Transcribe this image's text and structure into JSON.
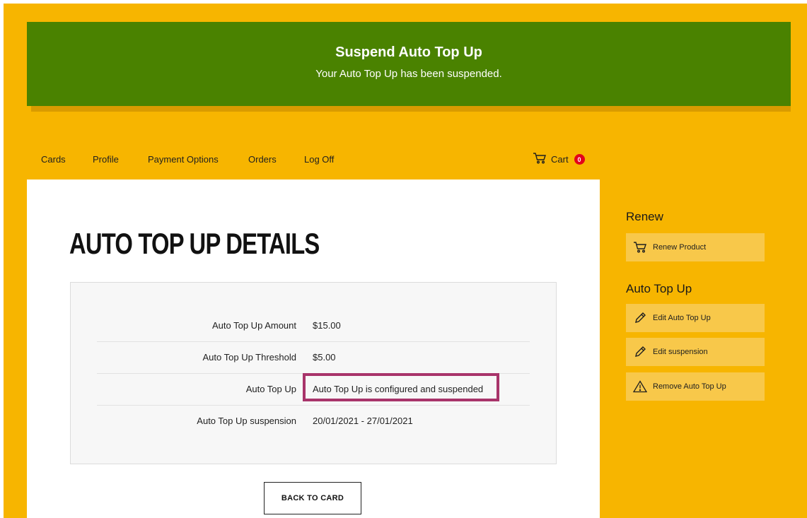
{
  "banner": {
    "title": "Suspend Auto Top Up",
    "message": "Your Auto Top Up has been suspended."
  },
  "nav": {
    "items": [
      "Cards",
      "Profile",
      "Payment Options",
      "Orders",
      "Log Off"
    ],
    "cart_label": "Cart",
    "cart_count": "0"
  },
  "main": {
    "title": "AUTO TOP UP DETAILS",
    "details": [
      {
        "label": "Auto Top Up Amount",
        "value": "$15.00"
      },
      {
        "label": "Auto Top Up Threshold",
        "value": "$5.00"
      },
      {
        "label": "Auto Top Up",
        "value": "Auto Top Up is configured and suspended"
      },
      {
        "label": "Auto Top Up suspension",
        "value": "20/01/2021 - 27/01/2021"
      }
    ],
    "back_button": "BACK TO CARD"
  },
  "sidebar": {
    "renew_heading": "Renew",
    "renew_button": "Renew Product",
    "auto_heading": "Auto Top Up",
    "edit_button": "Edit Auto Top Up",
    "edit_suspension_button": "Edit suspension",
    "remove_button": "Remove Auto Top Up"
  },
  "icons": {
    "cart": "cart-icon",
    "pencil": "pencil-icon",
    "warning": "warning-icon"
  },
  "colors": {
    "page_background": "#f7b500",
    "banner": "#4a8200",
    "highlight": "#a8346a",
    "cart_badge": "#e3001b",
    "side_button": "#f8c84a"
  }
}
